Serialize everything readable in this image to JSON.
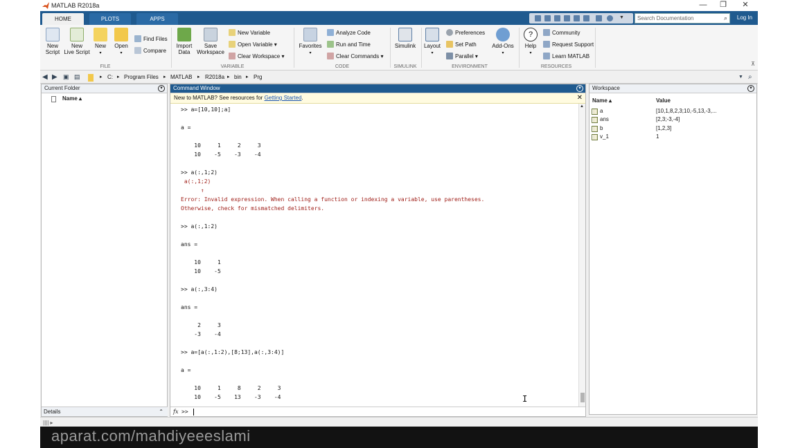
{
  "window": {
    "title": "MATLAB R2018a",
    "controls": [
      "—",
      "❐",
      "✕"
    ]
  },
  "tabs": [
    {
      "label": "HOME"
    },
    {
      "label": "PLOTS"
    },
    {
      "label": "APPS"
    }
  ],
  "search": {
    "placeholder": "Search Documentation",
    "icon": "search-icon"
  },
  "login_label": "Log In",
  "ribbon": {
    "file": {
      "group": "FILE",
      "new_script": "New\nScript",
      "new_live_script": "New\nLive Script",
      "new": "New",
      "open": "Open",
      "find_files": "Find Files",
      "compare": "Compare"
    },
    "variable": {
      "group": "VARIABLE",
      "import_data": "Import\nData",
      "save_workspace": "Save\nWorkspace",
      "new_variable": "New Variable",
      "open_variable": "Open Variable",
      "clear_workspace": "Clear Workspace"
    },
    "code": {
      "group": "CODE",
      "favorites": "Favorites",
      "analyze_code": "Analyze Code",
      "run_and_time": "Run and Time",
      "clear_commands": "Clear Commands"
    },
    "simulink": {
      "group": "SIMULINK",
      "simulink": "Simulink"
    },
    "environment": {
      "group": "ENVIRONMENT",
      "layout": "Layout",
      "preferences": "Preferences",
      "set_path": "Set Path",
      "parallel": "Parallel",
      "addons": "Add-Ons"
    },
    "resources": {
      "group": "RESOURCES",
      "help": "Help",
      "community": "Community",
      "request_support": "Request Support",
      "learn_matlab": "Learn MATLAB"
    }
  },
  "address": {
    "crumbs": [
      "C:",
      "Program Files",
      "MATLAB",
      "R2018a",
      "bin",
      "Prg"
    ]
  },
  "current_folder": {
    "title": "Current Folder",
    "column": "Name ▴",
    "details": "Details"
  },
  "command_window": {
    "title": "Command Window",
    "banner_text": "New to MATLAB? See resources for ",
    "banner_link": "Getting Started",
    "banner_end": ".",
    "lines": [
      {
        "t": ">> a=[10,10];a]",
        "err": false
      },
      {
        "t": "",
        "err": false
      },
      {
        "t": "a =",
        "err": false
      },
      {
        "t": "",
        "err": false
      },
      {
        "t": "    10     1     2     3",
        "err": false
      },
      {
        "t": "    10    -5    -3    -4",
        "err": false
      },
      {
        "t": "",
        "err": false
      },
      {
        "t": ">> a(:,1;2)",
        "err": false
      },
      {
        "t": " a(:,1;2)",
        "err": true
      },
      {
        "t": "      ↑",
        "err": true
      },
      {
        "t": "Error: Invalid expression. When calling a function or indexing a variable, use parentheses.",
        "err": true
      },
      {
        "t": "Otherwise, check for mismatched delimiters.",
        "err": true
      },
      {
        "t": "",
        "err": false
      },
      {
        "t": ">> a(:,1:2)",
        "err": false
      },
      {
        "t": "",
        "err": false
      },
      {
        "t": "ans =",
        "err": false
      },
      {
        "t": "",
        "err": false
      },
      {
        "t": "    10     1",
        "err": false
      },
      {
        "t": "    10    -5",
        "err": false
      },
      {
        "t": "",
        "err": false
      },
      {
        "t": ">> a(:,3:4)",
        "err": false
      },
      {
        "t": "",
        "err": false
      },
      {
        "t": "ans =",
        "err": false
      },
      {
        "t": "",
        "err": false
      },
      {
        "t": "     2     3",
        "err": false
      },
      {
        "t": "    -3    -4",
        "err": false
      },
      {
        "t": "",
        "err": false
      },
      {
        "t": ">> a=[a(:,1:2),[8;13],a(:,3:4)]",
        "err": false
      },
      {
        "t": "",
        "err": false
      },
      {
        "t": "a =",
        "err": false
      },
      {
        "t": "",
        "err": false
      },
      {
        "t": "    10     1     8     2     3",
        "err": false
      },
      {
        "t": "    10    -5    13    -3    -4",
        "err": false
      }
    ],
    "fx": "fx",
    "prompt": ">>"
  },
  "workspace": {
    "title": "Workspace",
    "col_name": "Name ▴",
    "col_value": "Value",
    "rows": [
      {
        "name": "a",
        "value": "[10,1,8,2,3;10,-5,13,-3,..."
      },
      {
        "name": "ans",
        "value": "[2,3;-3,-4]"
      },
      {
        "name": "b",
        "value": "[1,2,3]"
      },
      {
        "name": "v_1",
        "value": "1"
      }
    ]
  },
  "watermark": "aparat.com/mahdiyeeeslami",
  "colors": {
    "accent": "#1f5a8f",
    "error": "#a0201a",
    "banner": "#fffbe0"
  }
}
